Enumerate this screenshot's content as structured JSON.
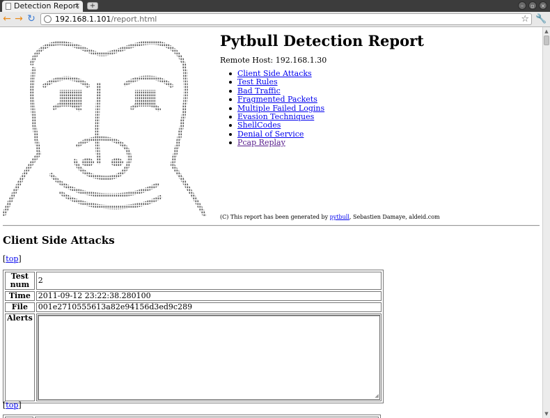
{
  "browser": {
    "tab_title": "Detection Report",
    "tab_close": "×",
    "new_tab": "+",
    "window_controls": [
      "–",
      "▫",
      "×"
    ],
    "url_host": "192.168.1.101",
    "url_path": "/report.html",
    "icons": {
      "back": "←",
      "forward": "→",
      "reload": "↻",
      "star": "☆",
      "wrench": "🔧"
    },
    "accent_colors": {
      "back_forward": "#e98b1c",
      "reload": "#3b7bd4"
    }
  },
  "page": {
    "title": "Pytbull Detection Report",
    "remote_host": "Remote Host: 192.168.1.30",
    "nav": [
      {
        "label": "Client Side Attacks"
      },
      {
        "label": "Test Rules"
      },
      {
        "label": "Bad Traffic"
      },
      {
        "label": "Fragmented Packets"
      },
      {
        "label": "Multiple Failed Logins"
      },
      {
        "label": "Evasion Techniques"
      },
      {
        "label": "ShellCodes"
      },
      {
        "label": "Denial of Service"
      },
      {
        "label": "Pcap Replay"
      }
    ],
    "credit": {
      "prefix": "(C) This report has been generated by ",
      "link": "pytbull",
      "suffix": ", Sebastien Damaye, aldeid.com"
    },
    "section_title": "Client Side Attacks",
    "top_link": "top",
    "bracket_open": "[",
    "bracket_close": "]",
    "test": {
      "test_num_label": "Test num",
      "test_num": "2",
      "time_label": "Time",
      "time": "2011-09-12 23:22:38.280100",
      "file_label": "File",
      "file": "001e2710555613a82e94156d3ed9c289",
      "alerts_label": "Alerts",
      "alerts": ""
    }
  }
}
